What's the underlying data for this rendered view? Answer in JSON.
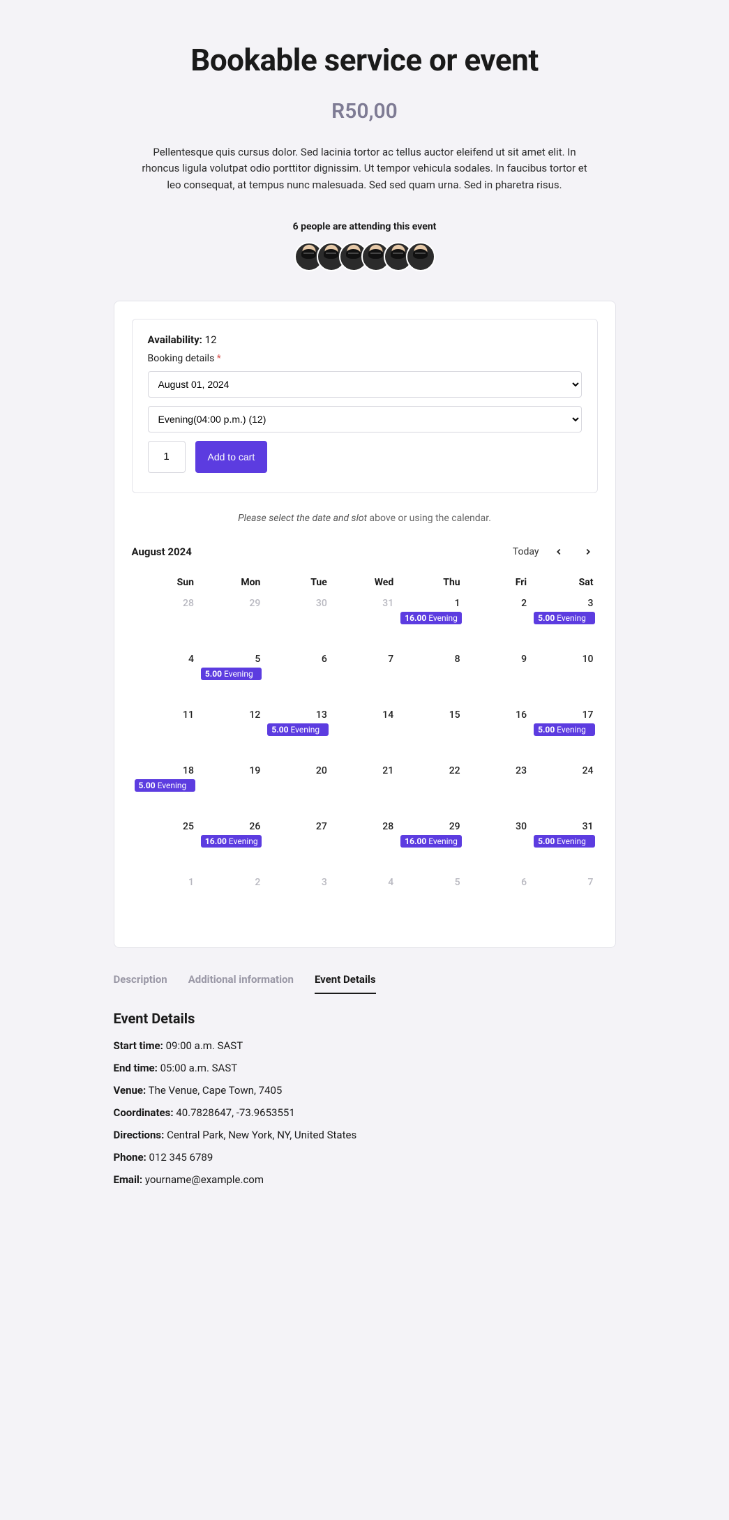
{
  "title": "Bookable service or event",
  "price": "R50,00",
  "description": "Pellentesque quis cursus dolor. Sed lacinia tortor ac tellus auctor eleifend ut sit amet elit. In rhoncus ligula volutpat odio porttitor dignissim. Ut tempor vehicula sodales. In faucibus tortor et leo consequat, at tempus nunc malesuada. Sed sed quam urna. Sed in pharetra risus.",
  "attendance": {
    "text": "6 people are attending this event",
    "count": 6
  },
  "booking": {
    "availability_label": "Availability:",
    "availability_value": "12",
    "details_label": "Booking details",
    "date_value": "August 01, 2024",
    "slot_value": "Evening(04:00 p.m.) (12)",
    "qty_value": "1",
    "add_label": "Add to cart"
  },
  "hint_em": "Please select the date and slot",
  "hint_rest": " above or using the calendar.",
  "calendar": {
    "month_label": "August 2024",
    "today_label": "Today",
    "dow": [
      "Sun",
      "Mon",
      "Tue",
      "Wed",
      "Thu",
      "Fri",
      "Sat"
    ],
    "weeks": [
      [
        {
          "n": "28",
          "other": true
        },
        {
          "n": "29",
          "other": true
        },
        {
          "n": "30",
          "other": true
        },
        {
          "n": "31",
          "other": true
        },
        {
          "n": "1",
          "ev": {
            "p": "16.00",
            "t": "Evening"
          }
        },
        {
          "n": "2"
        },
        {
          "n": "3",
          "ev": {
            "p": "5.00",
            "t": "Evening"
          }
        }
      ],
      [
        {
          "n": "4"
        },
        {
          "n": "5",
          "ev": {
            "p": "5.00",
            "t": "Evening"
          }
        },
        {
          "n": "6"
        },
        {
          "n": "7"
        },
        {
          "n": "8"
        },
        {
          "n": "9"
        },
        {
          "n": "10"
        }
      ],
      [
        {
          "n": "11"
        },
        {
          "n": "12"
        },
        {
          "n": "13",
          "ev": {
            "p": "5.00",
            "t": "Evening"
          }
        },
        {
          "n": "14"
        },
        {
          "n": "15"
        },
        {
          "n": "16"
        },
        {
          "n": "17",
          "ev": {
            "p": "5.00",
            "t": "Evening"
          }
        }
      ],
      [
        {
          "n": "18",
          "ev": {
            "p": "5.00",
            "t": "Evening"
          }
        },
        {
          "n": "19"
        },
        {
          "n": "20"
        },
        {
          "n": "21"
        },
        {
          "n": "22"
        },
        {
          "n": "23"
        },
        {
          "n": "24"
        }
      ],
      [
        {
          "n": "25"
        },
        {
          "n": "26",
          "ev": {
            "p": "16.00",
            "t": "Evening"
          }
        },
        {
          "n": "27"
        },
        {
          "n": "28"
        },
        {
          "n": "29",
          "ev": {
            "p": "16.00",
            "t": "Evening"
          }
        },
        {
          "n": "30"
        },
        {
          "n": "31",
          "ev": {
            "p": "5.00",
            "t": "Evening"
          }
        }
      ],
      [
        {
          "n": "1",
          "other": true
        },
        {
          "n": "2",
          "other": true
        },
        {
          "n": "3",
          "other": true
        },
        {
          "n": "4",
          "other": true
        },
        {
          "n": "5",
          "other": true
        },
        {
          "n": "6",
          "other": true
        },
        {
          "n": "7",
          "other": true
        }
      ]
    ]
  },
  "tabs": {
    "desc": "Description",
    "addl": "Additional information",
    "events": "Event Details"
  },
  "details": {
    "heading": "Event Details",
    "rows": [
      {
        "k": "Start time:",
        "v": " 09:00 a.m. SAST"
      },
      {
        "k": "End time:",
        "v": " 05:00 a.m. SAST"
      },
      {
        "k": "Venue:",
        "v": " The Venue, Cape Town, 7405"
      },
      {
        "k": "Coordinates:",
        "v": " 40.7828647, -73.9653551"
      },
      {
        "k": "Directions:",
        "v": " Central Park, New York, NY, United States"
      },
      {
        "k": "Phone:",
        "v": " 012 345 6789"
      },
      {
        "k": "Email:",
        "v": " yourname@example.com"
      }
    ]
  }
}
